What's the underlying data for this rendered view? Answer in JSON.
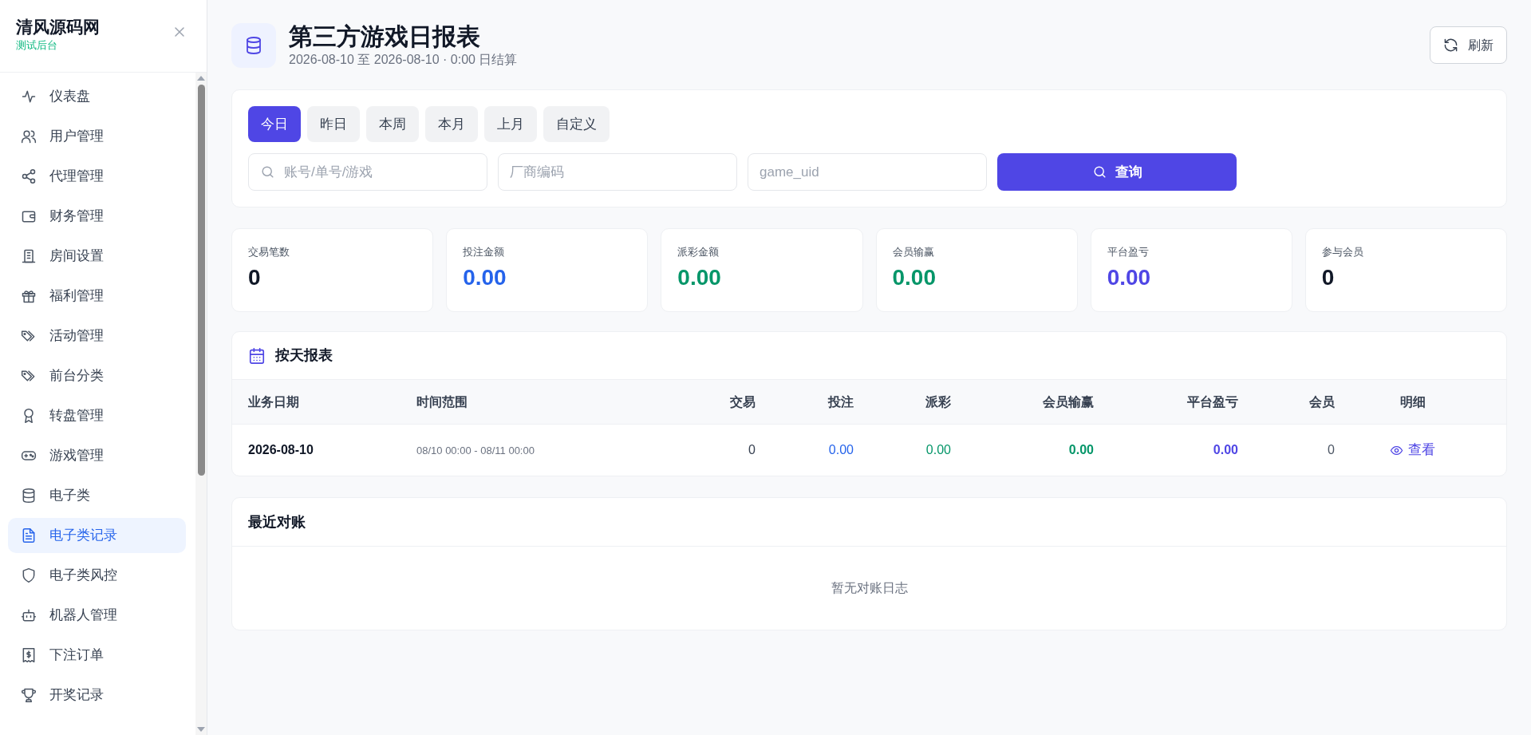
{
  "sidebar": {
    "brand": "清风源码网",
    "subtitle": "测试后台",
    "items": [
      {
        "label": "仪表盘",
        "selected": false
      },
      {
        "label": "用户管理",
        "selected": false
      },
      {
        "label": "代理管理",
        "selected": false
      },
      {
        "label": "财务管理",
        "selected": false
      },
      {
        "label": "房间设置",
        "selected": false
      },
      {
        "label": "福利管理",
        "selected": false
      },
      {
        "label": "活动管理",
        "selected": false
      },
      {
        "label": "前台分类",
        "selected": false
      },
      {
        "label": "转盘管理",
        "selected": false
      },
      {
        "label": "游戏管理",
        "selected": false
      },
      {
        "label": "电子类",
        "selected": false
      },
      {
        "label": "电子类记录",
        "selected": true
      },
      {
        "label": "电子类风控",
        "selected": false
      },
      {
        "label": "机器人管理",
        "selected": false
      },
      {
        "label": "下注订单",
        "selected": false
      },
      {
        "label": "开奖记录",
        "selected": false
      }
    ]
  },
  "header": {
    "title": "第三方游戏日报表",
    "subtitle": "2026-08-10 至 2026-08-10 · 0:00 日结算",
    "refresh_button": "刷新"
  },
  "filters": {
    "periods": [
      {
        "label": "今日",
        "selected": true
      },
      {
        "label": "昨日",
        "selected": false
      },
      {
        "label": "本周",
        "selected": false
      },
      {
        "label": "本月",
        "selected": false
      },
      {
        "label": "上月",
        "selected": false
      },
      {
        "label": "自定义",
        "selected": false
      }
    ],
    "search": {
      "placeholder": "账号/单号/游戏"
    },
    "vendor": {
      "placeholder": "厂商编码"
    },
    "game_uid": {
      "placeholder": "game_uid"
    },
    "query_button": "查询"
  },
  "stats": [
    {
      "label": "交易笔数",
      "value": "0",
      "color": "#111827"
    },
    {
      "label": "投注金额",
      "value": "0.00",
      "color": "#2563eb"
    },
    {
      "label": "派彩金额",
      "value": "0.00",
      "color": "#059669"
    },
    {
      "label": "会员输赢",
      "value": "0.00",
      "color": "#059669"
    },
    {
      "label": "平台盈亏",
      "value": "0.00",
      "color": "#4f46e5"
    },
    {
      "label": "参与会员",
      "value": "0",
      "color": "#111827"
    }
  ],
  "daily_report": {
    "title": "按天报表",
    "columns": [
      "业务日期",
      "时间范围",
      "交易",
      "投注",
      "派彩",
      "会员输赢",
      "平台盈亏",
      "会员",
      "明细"
    ],
    "rows": [
      {
        "date": "2026-08-10",
        "range": "08/10 00:00 - 08/11 00:00",
        "trades": "0",
        "bets": "0.00",
        "payout": "0.00",
        "member_result": "0.00",
        "platform_result": "0.00",
        "members": "0",
        "detail_link": "查看"
      }
    ]
  },
  "recent_reconciliation": {
    "title": "最近对账",
    "empty_text": "暂无对账日志"
  }
}
